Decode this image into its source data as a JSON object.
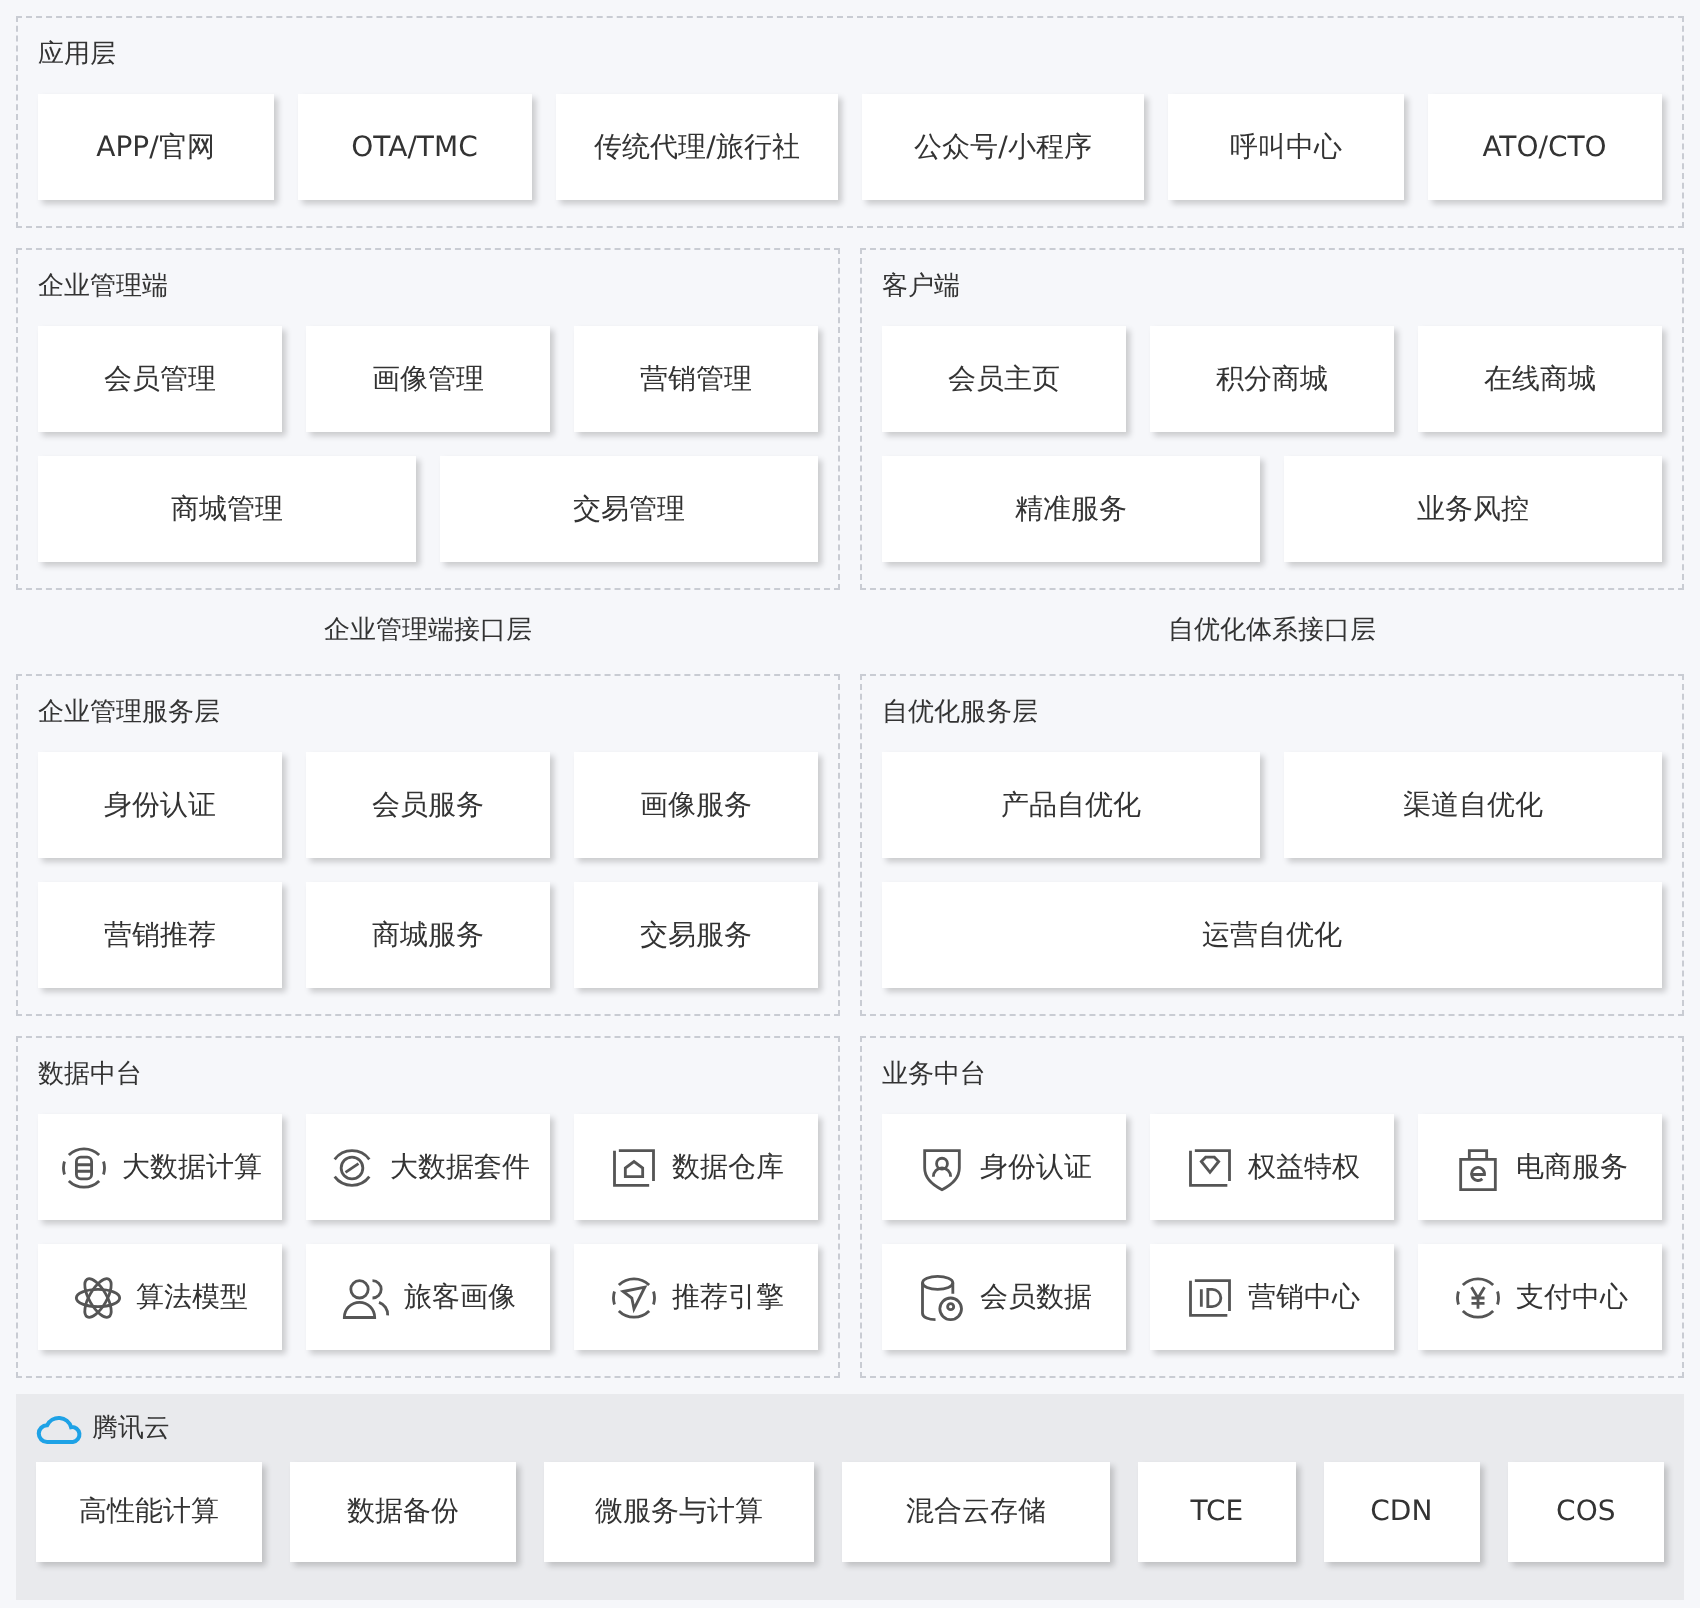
{
  "app_layer": {
    "title": "应用层",
    "items": [
      "APP/官网",
      "OTA/TMC",
      "传统代理/旅行社",
      "公众号/小程序",
      "呼叫中心",
      "ATO/CTO"
    ]
  },
  "middle": [
    {
      "kind": "pair",
      "left": {
        "kind": "plain",
        "title": "企业管理端",
        "rows": [
          [
            "会员管理",
            "画像管理",
            "营销管理"
          ],
          [
            "商城管理",
            "交易管理"
          ]
        ]
      },
      "right": {
        "kind": "plain",
        "title": "客户端",
        "rows": [
          [
            "会员主页",
            "积分商城",
            "在线商城"
          ],
          [
            "精准服务",
            "业务风控"
          ]
        ]
      }
    },
    {
      "kind": "labels",
      "left": "企业管理端接口层",
      "right": "自优化体系接口层"
    },
    {
      "kind": "pair",
      "left": {
        "kind": "plain",
        "title": "企业管理服务层",
        "rows": [
          [
            "身份认证",
            "会员服务",
            "画像服务"
          ],
          [
            "营销推荐",
            "商城服务",
            "交易服务"
          ]
        ]
      },
      "right": {
        "kind": "plain",
        "title": "自优化服务层",
        "rows": [
          [
            "产品自优化",
            "渠道自优化"
          ],
          [
            "运营自优化"
          ]
        ]
      }
    },
    {
      "kind": "pair",
      "left": {
        "kind": "data_icons",
        "title": "数据中台",
        "rows": [
          [
            "大数据计算",
            "大数据套件",
            "数据仓库"
          ],
          [
            "算法模型",
            "旅客画像",
            "推荐引擎"
          ]
        ]
      },
      "right": {
        "kind": "business_icons",
        "title": "业务中台",
        "rows": [
          [
            "身份认证",
            "权益特权",
            "电商服务"
          ],
          [
            "会员数据",
            "营销中心",
            "支付中心"
          ]
        ]
      }
    }
  ],
  "cloud": {
    "title": "腾讯云",
    "items": [
      "高性能计算",
      "数据备份",
      "微服务与计算",
      "混合云存储",
      "TCE",
      "CDN",
      "COS"
    ]
  }
}
